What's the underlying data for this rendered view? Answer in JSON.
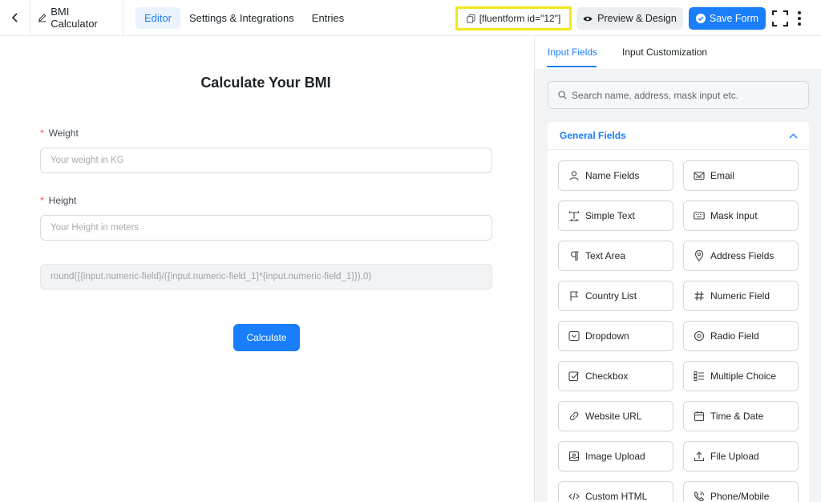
{
  "header": {
    "form_title": "BMI Calculator",
    "tabs": [
      {
        "label": "Editor",
        "active": true
      },
      {
        "label": "Settings & Integrations",
        "active": false
      },
      {
        "label": "Entries",
        "active": false
      }
    ],
    "shortcode": "[fluentform id=\"12\"]",
    "preview_label": "Preview & Design",
    "save_label": "Save Form"
  },
  "form": {
    "title": "Calculate Your BMI",
    "fields": [
      {
        "label": "Weight",
        "required_mark": "*",
        "placeholder": "Your weight in KG"
      },
      {
        "label": "Height",
        "required_mark": "*",
        "placeholder": "Your Height in meters"
      }
    ],
    "formula": "round({{input.numeric-field}/({input.numeric-field_1}*{input.numeric-field_1}}),0)",
    "submit_label": "Calculate"
  },
  "panel": {
    "tabs": [
      {
        "label": "Input Fields",
        "active": true
      },
      {
        "label": "Input Customization",
        "active": false
      }
    ],
    "search_placeholder": "Search name, address, mask input etc.",
    "group_title": "General Fields",
    "fields": [
      {
        "label": "Name Fields",
        "icon": "user-icon"
      },
      {
        "label": "Email",
        "icon": "envelope-icon"
      },
      {
        "label": "Simple Text",
        "icon": "text-cursor-icon"
      },
      {
        "label": "Mask Input",
        "icon": "keyboard-icon"
      },
      {
        "label": "Text Area",
        "icon": "paragraph-icon"
      },
      {
        "label": "Address Fields",
        "icon": "map-pin-icon"
      },
      {
        "label": "Country List",
        "icon": "flag-icon"
      },
      {
        "label": "Numeric Field",
        "icon": "hash-icon"
      },
      {
        "label": "Dropdown",
        "icon": "dropdown-icon"
      },
      {
        "label": "Radio Field",
        "icon": "radio-icon"
      },
      {
        "label": "Checkbox",
        "icon": "checkbox-icon"
      },
      {
        "label": "Multiple Choice",
        "icon": "list-icon"
      },
      {
        "label": "Website URL",
        "icon": "link-icon"
      },
      {
        "label": "Time & Date",
        "icon": "calendar-icon"
      },
      {
        "label": "Image Upload",
        "icon": "image-icon"
      },
      {
        "label": "File Upload",
        "icon": "upload-icon"
      },
      {
        "label": "Custom HTML",
        "icon": "code-icon"
      },
      {
        "label": "Phone/Mobile",
        "icon": "phone-icon"
      }
    ]
  },
  "colors": {
    "accent": "#1a7efb",
    "highlight": "#f1e81d",
    "required": "#f04e4e"
  }
}
